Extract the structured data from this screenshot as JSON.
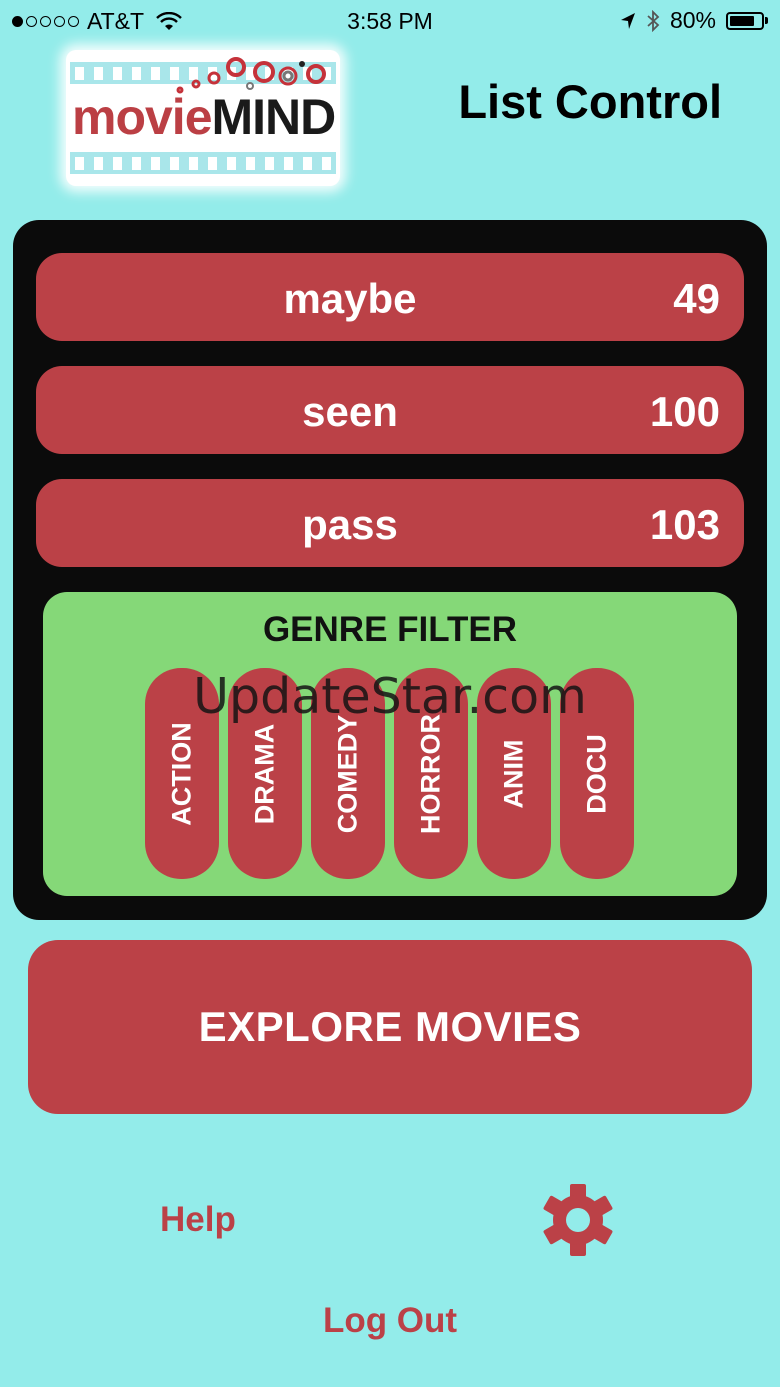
{
  "status_bar": {
    "carrier": "AT&T",
    "time": "3:58 PM",
    "battery": "80%",
    "signal_bars_filled": 1,
    "signal_bars_total": 5
  },
  "header": {
    "logo": {
      "part1": "movie",
      "part2": "MIND"
    },
    "title": "List Control"
  },
  "lists": [
    {
      "label": "maybe",
      "count": "49"
    },
    {
      "label": "seen",
      "count": "100"
    },
    {
      "label": "pass",
      "count": "103"
    }
  ],
  "genre_filter": {
    "title": "GENRE FILTER",
    "genres": [
      "ACTION",
      "DRAMA",
      "COMEDY",
      "HORROR",
      "ANIM",
      "DOCU"
    ]
  },
  "watermark": "UpdateStar.com",
  "explore_button": "EXPLORE MOVIES",
  "help_label": "Help",
  "logout_label": "Log Out",
  "colors": {
    "background": "#93ecea",
    "accent_red": "#bb4147",
    "genre_green": "#85d878",
    "panel_black": "#0b0b0b"
  },
  "icons": [
    "wifi-icon",
    "location-arrow-icon",
    "bluetooth-icon",
    "battery-icon",
    "gear-icon"
  ]
}
